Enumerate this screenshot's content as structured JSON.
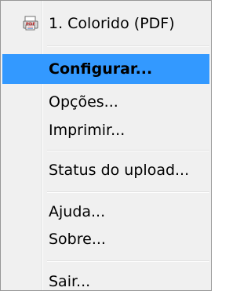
{
  "menu": {
    "items": [
      {
        "label": "1. Colorido (PDF)",
        "icon": "pdf-printer-icon"
      },
      {
        "label": "Configurar...",
        "selected": true
      },
      {
        "label": "Opções..."
      },
      {
        "label": "Imprimir..."
      },
      {
        "label": "Status do upload..."
      },
      {
        "label": "Ajuda..."
      },
      {
        "label": "Sobre..."
      },
      {
        "label": "Sair..."
      }
    ],
    "pdf_icon_text": "PDF"
  },
  "colors": {
    "selection": "#3399ff",
    "background": "#f0f0f0",
    "border": "#979797"
  }
}
